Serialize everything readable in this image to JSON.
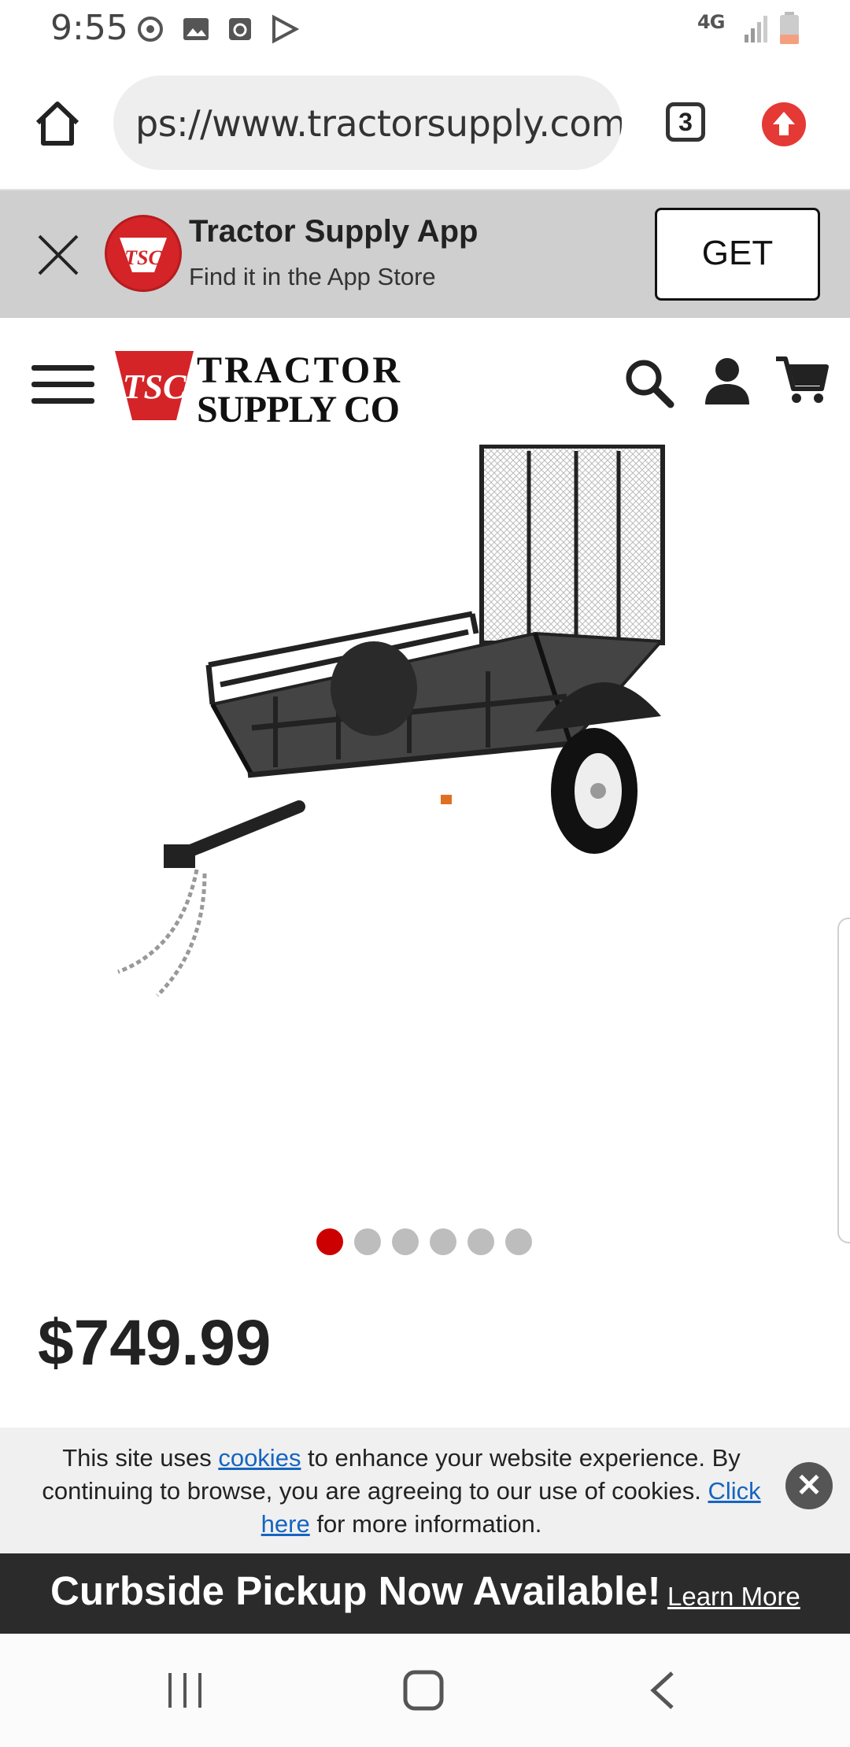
{
  "status_bar": {
    "time": "9:55",
    "network": "4G",
    "icons": [
      "sync-icon",
      "gallery-icon",
      "calendar-icon",
      "play-store-icon",
      "signal-icon",
      "battery-icon"
    ]
  },
  "browser": {
    "url": "ps://www.tractorsupply.com",
    "tab_count": "3",
    "icons": [
      "home-icon",
      "tabs-icon",
      "update-icon"
    ]
  },
  "app_banner": {
    "title": "Tractor Supply App",
    "subtitle": "Find it in the App Store",
    "button_label": "GET",
    "logo_text": "TSC"
  },
  "site_header": {
    "logo_line1": "TRACTOR",
    "logo_line2": "SUPPLY CO",
    "icons": [
      "menu-icon",
      "search-icon",
      "account-icon",
      "cart-icon"
    ]
  },
  "product": {
    "image": "utility-trailer",
    "price": "$749.99",
    "carousel": {
      "count": 6,
      "active_index": 0
    }
  },
  "cookie_notice": {
    "text_before_link": "This site uses ",
    "link1": "cookies",
    "text_mid": " to enhance your website experience. By continuing to browse, you are agreeing to our use of cookies. ",
    "link2": "Click here",
    "text_after": " for more information."
  },
  "promo_bar": {
    "text": "Curbside Pickup Now Available!",
    "link": "Learn More"
  },
  "colors": {
    "brand_red": "#cc0000",
    "banner_bg": "#cfcfcf",
    "promo_bg": "#2b2b2b",
    "link_blue": "#1565c0"
  }
}
